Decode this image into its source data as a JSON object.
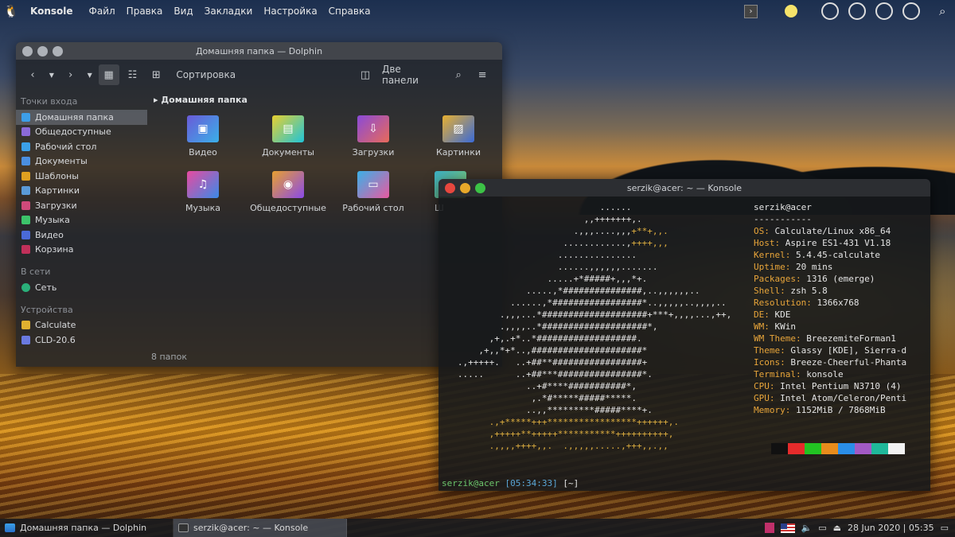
{
  "top_panel": {
    "app_name": "Konsole",
    "menu": [
      "Файл",
      "Правка",
      "Вид",
      "Закладки",
      "Настройка",
      "Справка"
    ]
  },
  "dolphin": {
    "title": "Домашняя папка — Dolphin",
    "sort_label": "Сортировка",
    "split_label": "Две панели",
    "breadcrumb": "Домашняя папка",
    "status": "8 папок",
    "sections": {
      "places": "Точки входа",
      "network": "В сети",
      "devices": "Устройства"
    },
    "places": [
      "Домашняя папка",
      "Общедоступные",
      "Рабочий стол",
      "Документы",
      "Шаблоны",
      "Картинки",
      "Загрузки",
      "Музыка",
      "Видео",
      "Корзина"
    ],
    "network_items": [
      "Сеть"
    ],
    "devices": [
      "Calculate",
      "CLD-20.6"
    ],
    "files": [
      "Видео",
      "Документы",
      "Загрузки",
      "Картинки",
      "Музыка",
      "Общедоступные",
      "Рабочий стол",
      "Ш"
    ]
  },
  "konsole": {
    "title": "serzik@acer: ~ — Konsole",
    "user_host": "serzik@acer",
    "separator": "-----------",
    "info": [
      {
        "k": "OS",
        "v": "Calculate/Linux x86_64"
      },
      {
        "k": "Host",
        "v": "Aspire ES1-431 V1.18"
      },
      {
        "k": "Kernel",
        "v": "5.4.45-calculate"
      },
      {
        "k": "Uptime",
        "v": "20 mins"
      },
      {
        "k": "Packages",
        "v": "1316 (emerge)"
      },
      {
        "k": "Shell",
        "v": "zsh 5.8"
      },
      {
        "k": "Resolution",
        "v": "1366x768"
      },
      {
        "k": "DE",
        "v": "KDE"
      },
      {
        "k": "WM",
        "v": "KWin"
      },
      {
        "k": "WM Theme",
        "v": "BreezemiteForman1"
      },
      {
        "k": "Theme",
        "v": "Glassy [KDE], Sierra-d"
      },
      {
        "k": "Icons",
        "v": "Breeze-Cheerful-Phanta"
      },
      {
        "k": "Terminal",
        "v": "konsole"
      },
      {
        "k": "CPU",
        "v": "Intel Pentium N3710 (4)"
      },
      {
        "k": "GPU",
        "v": "Intel Atom/Celeron/Penti"
      },
      {
        "k": "Memory",
        "v": "1152MiB / 7868MiB"
      }
    ],
    "palette": [
      "#111111",
      "#e52b2b",
      "#22c322",
      "#e88c1c",
      "#2a8ee8",
      "#a25ac4",
      "#1fb89a",
      "#f2f2f2"
    ],
    "prompt_user": "serzik@acer",
    "prompt_time": "[05:34:33]",
    "prompt_dir": "[~]",
    "prompt_arrow": "-> %"
  },
  "taskbar": {
    "tasks": [
      "Домашняя папка — Dolphin",
      "serzik@acer: ~ — Konsole"
    ],
    "clock": "28 Jun 2020 | 05:35"
  }
}
